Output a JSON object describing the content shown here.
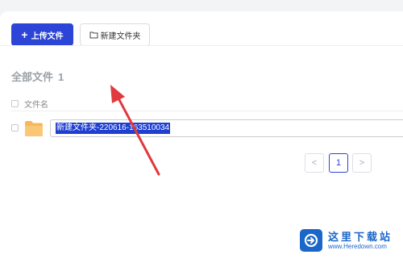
{
  "toolbar": {
    "upload_label": "上传文件",
    "new_folder_label": "新建文件夹"
  },
  "section": {
    "title": "全部文件",
    "count": "1"
  },
  "file_list": {
    "column_header": "文件名",
    "rows": [
      {
        "name_input_value": "新建文件夹-220616-163510034",
        "icon": "folder-icon"
      }
    ]
  },
  "pagination": {
    "prev_symbol": "<",
    "current_page": "1",
    "next_symbol": ">"
  },
  "watermark": {
    "site_name": "这里下载站",
    "site_url": "www.Heredown.com"
  },
  "colors": {
    "primary": "#2c45d6",
    "selection": "#1f3fd1",
    "folder": "#f6b85a",
    "annotation_arrow": "#e0393e",
    "watermark": "#1a66c9"
  }
}
